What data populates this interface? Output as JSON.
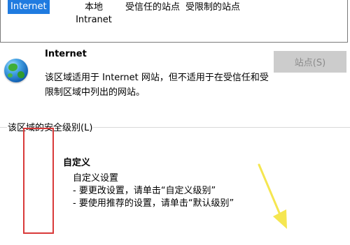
{
  "zones": {
    "internet": "Internet",
    "intranet": "本地 Intranet",
    "trusted": "受信任的站点",
    "restricted": "受限制的站点"
  },
  "selected_zone": {
    "title": "Internet",
    "description": "该区域适用于 Internet 网站，但不适用于在受信任和受限制区域中列出的网站。",
    "sites_button": "站点(S)"
  },
  "security_level": {
    "group_label": "该区域的安全级别(L)",
    "title": "自定义",
    "lines": [
      "自定义设置",
      "- 要更改设置，请单击“自定义级别”",
      "- 要使用推荐的设置，请单击“默认级别”"
    ]
  },
  "annotation_colors": {
    "box": "#d93a3a",
    "arrow": "#f5e650"
  }
}
